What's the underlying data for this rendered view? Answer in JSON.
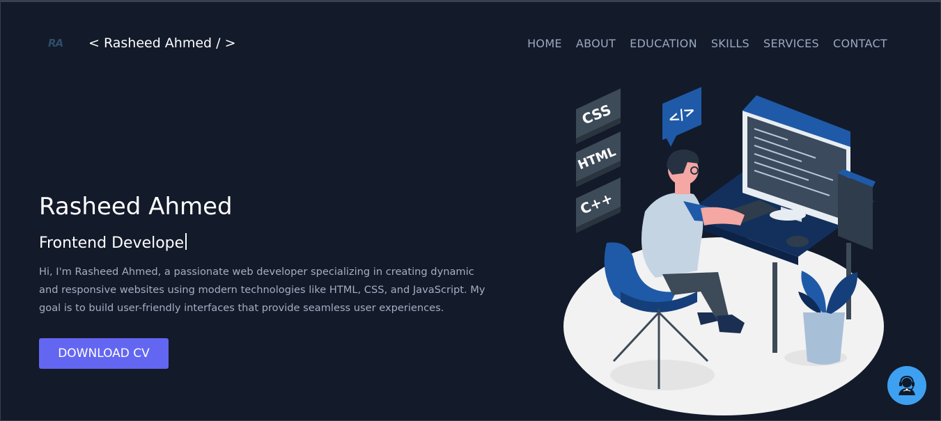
{
  "header": {
    "logo_text": "RA",
    "brand": "< Rasheed Ahmed / >",
    "nav": [
      "HOME",
      "ABOUT",
      "EDUCATION",
      "SKILLS",
      "SERVICES",
      "CONTACT"
    ]
  },
  "hero": {
    "name": "Rasheed Ahmed",
    "role": "Frontend Develope",
    "description": "Hi, I'm Rasheed Ahmed, a passionate web developer specializing in creating dynamic and responsive websites using modern technologies like HTML, CSS, and JavaScript. My goal is to build user-friendly interfaces that provide seamless user experiences.",
    "cta_label": "DOWNLOAD CV"
  },
  "illustration": {
    "badges": [
      "CSS",
      "HTML",
      "C++"
    ],
    "code_badge": "</>"
  },
  "colors": {
    "background": "#131a2a",
    "accent": "#6366f1",
    "nav_text": "#9aa9bf",
    "chat_button": "#3ea0f0"
  },
  "icons": {
    "chat": "support-agent-icon"
  }
}
